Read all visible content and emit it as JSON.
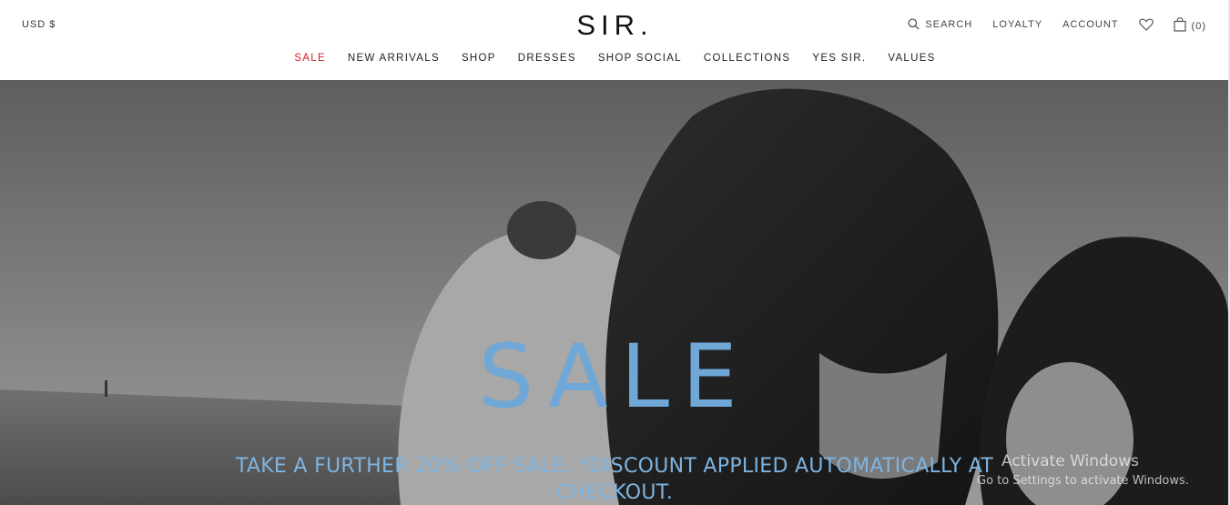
{
  "header": {
    "currency": "USD $",
    "logo": "SIR.",
    "utility": {
      "search_label": "SEARCH",
      "loyalty_label": "LOYALTY",
      "account_label": "ACCOUNT",
      "cart_count": "(0)"
    }
  },
  "nav": {
    "items": [
      {
        "label": "SALE"
      },
      {
        "label": "NEW ARRIVALS"
      },
      {
        "label": "SHOP"
      },
      {
        "label": "DRESSES"
      },
      {
        "label": "SHOP SOCIAL"
      },
      {
        "label": "COLLECTIONS"
      },
      {
        "label": "YES SIR."
      },
      {
        "label": "VALUES"
      }
    ]
  },
  "hero": {
    "title": "SALE",
    "subtitle": "TAKE A FURTHER 20% OFF SALE. *DISCOUNT APPLIED AUTOMATICALLY AT CHECKOUT."
  },
  "watermark": {
    "title": "Activate Windows",
    "subtitle": "Go to Settings to activate Windows."
  },
  "colors": {
    "sale_accent": "#d21f1f",
    "hero_text": "#6fa7d6"
  },
  "icons": [
    "search-icon",
    "heart-icon",
    "bag-icon"
  ]
}
